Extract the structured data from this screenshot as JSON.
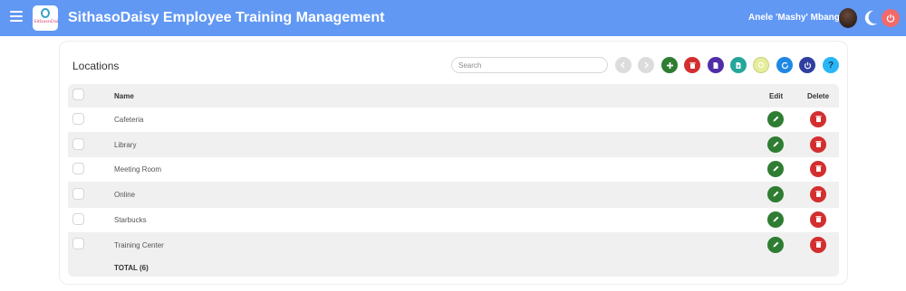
{
  "app": {
    "title": "SithasoDaisy Employee Training Management",
    "logo_text": "SithasoDaisy",
    "user_name": "Anele 'Mashy' Mbanga"
  },
  "colors": {
    "appbar": "#6198f4",
    "add": "#2e7d32",
    "delete": "#d32f2f",
    "purple": "#512da8",
    "teal": "#26a69a",
    "yellow": "#e6ee9c",
    "blue": "#1e88e5",
    "indigo": "#303f9f",
    "help": "#29b6f6"
  },
  "page": {
    "title": "Locations",
    "search_placeholder": "Search"
  },
  "toolbar": {
    "icons": [
      "chevron-left-icon",
      "chevron-right-icon",
      "add-icon",
      "delete-icon",
      "pdf-icon",
      "excel-icon",
      "yellow-circle-icon",
      "refresh-icon",
      "power-icon",
      "help-icon"
    ]
  },
  "table": {
    "columns": {
      "name": "Name",
      "edit": "Edit",
      "delete": "Delete"
    },
    "rows": [
      "Cafeteria",
      "Library",
      "Meeting Room",
      "Online",
      "Starbucks",
      "Training Center"
    ],
    "total_label": "TOTAL (6)"
  }
}
